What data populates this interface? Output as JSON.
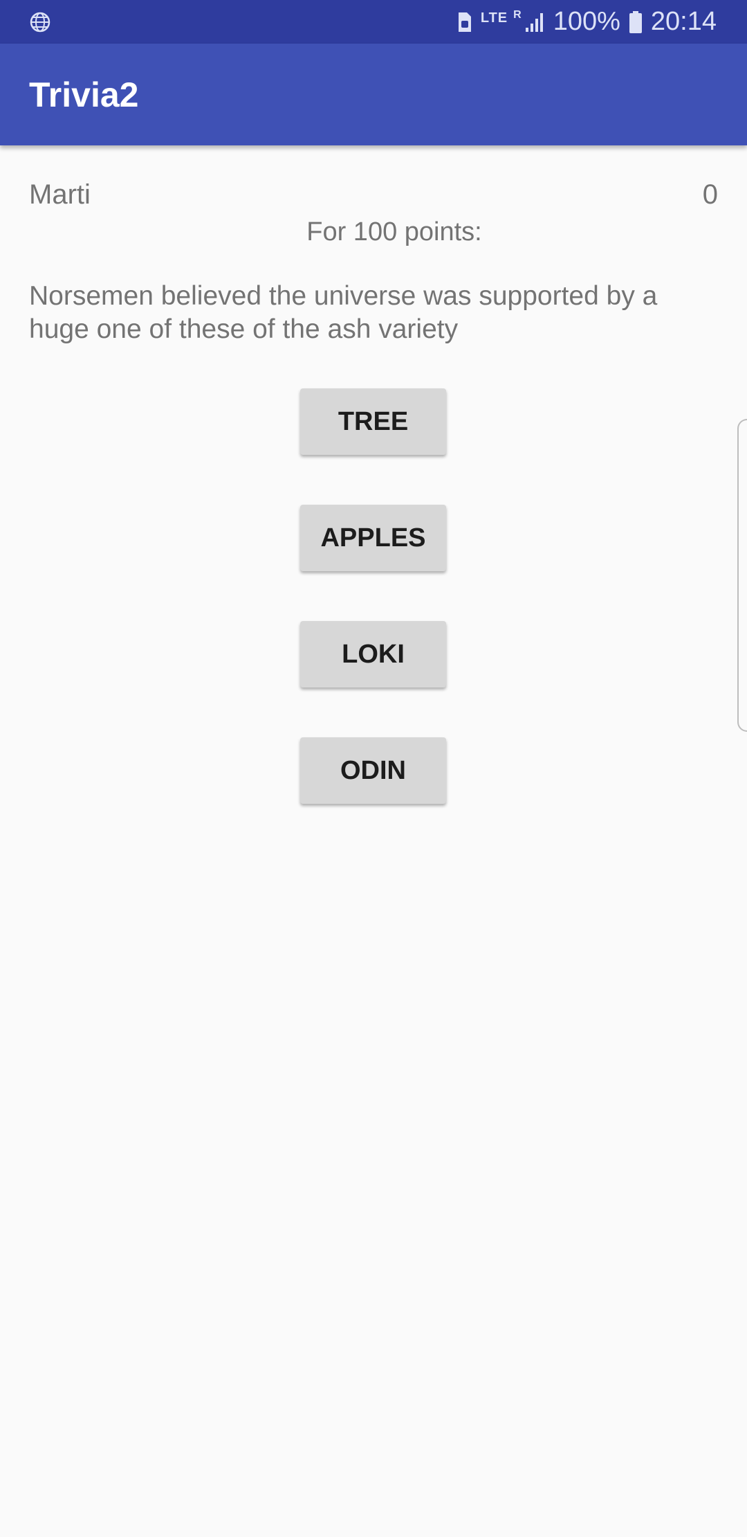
{
  "status_bar": {
    "left_icon": "globe-icon",
    "icons": [
      "sim-card-icon",
      "lte-icon",
      "signal-icon",
      "battery-icon"
    ],
    "network": "LTE",
    "roaming": "R",
    "battery": "100%",
    "time": "20:14",
    "background": "#2F3C9E"
  },
  "app_bar": {
    "title": "Trivia2",
    "background": "#3F51B5"
  },
  "game": {
    "player_name": "Marti",
    "score": "0",
    "points_label": "For 100 points:",
    "question": "Norsemen believed the universe was supported by a huge one of these of the ash variety",
    "answers": [
      "TREE",
      "APPLES",
      "LOKI",
      "ODIN"
    ]
  },
  "colors": {
    "background": "#FAFAFA",
    "text_secondary": "#737373",
    "button_bg": "#D7D7D7",
    "button_text": "#1C1C1C"
  }
}
